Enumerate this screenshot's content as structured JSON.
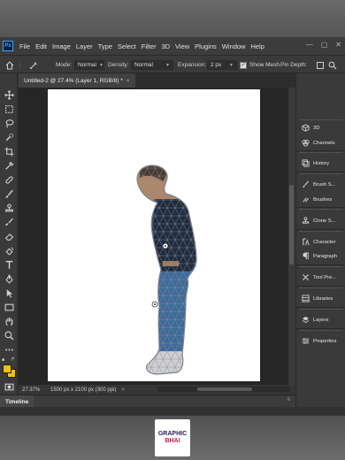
{
  "app": {
    "logo_label": "Ps",
    "menu": [
      "File",
      "Edit",
      "Image",
      "Layer",
      "Type",
      "Select",
      "Filter",
      "3D",
      "View",
      "Plugins",
      "Window",
      "Help"
    ]
  },
  "options_bar": {
    "mode_label": "Mode:",
    "mode_value": "Normal",
    "density_label": "Density:",
    "density_value": "Normal",
    "expansion_label": "Expansion:",
    "expansion_value": "2 px",
    "show_mesh_label": "Show Mesh",
    "show_mesh_checked": "✓",
    "pin_depth_label": "Pin Depth:"
  },
  "document": {
    "tab_title": "Untitled-2 @ 27.4% (Layer 1, RGB/8) *",
    "tab_close": "×",
    "zoom": "27.37%",
    "info": "1500 px x 2100 px (300 ppi)",
    "info_arrow": ">"
  },
  "timeline": {
    "label": "Timeline",
    "menu": "≡"
  },
  "panels": [
    {
      "label": "3D",
      "icon": "cube-icon"
    },
    {
      "label": "Channels",
      "icon": "channels-icon"
    },
    {
      "label": "History",
      "icon": "history-icon"
    },
    {
      "label": "Brush S...",
      "icon": "brush-settings-icon"
    },
    {
      "label": "Brushes",
      "icon": "brushes-icon"
    },
    {
      "label": "Clone S...",
      "icon": "clone-source-icon"
    },
    {
      "label": "Character",
      "icon": "character-icon"
    },
    {
      "label": "Paragraph",
      "icon": "paragraph-icon"
    },
    {
      "label": "Tool Pre...",
      "icon": "tool-presets-icon"
    },
    {
      "label": "Libraries",
      "icon": "libraries-icon"
    },
    {
      "label": "Layers",
      "icon": "layers-icon"
    },
    {
      "label": "Properties",
      "icon": "properties-icon"
    }
  ],
  "colors": {
    "foreground": "#f5c000",
    "background": "#f5c000",
    "accent": "#31a8ff",
    "mesh": "#8a9098"
  },
  "watermark": {
    "line1": "GRAPHIC",
    "line2": "BHAI"
  }
}
